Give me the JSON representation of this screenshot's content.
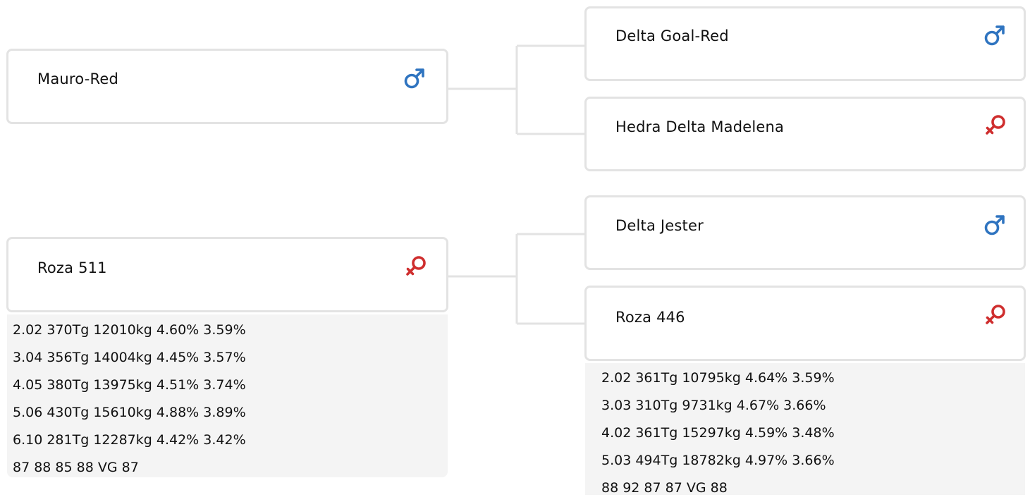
{
  "tree": {
    "left": [
      {
        "name": "Mauro-Red",
        "sex": "male",
        "icon": "male-icon"
      },
      {
        "name": "Roza 511",
        "sex": "female",
        "icon": "female-icon",
        "stats": [
          "2.02 370Tg 12010kg 4.60% 3.59%",
          "3.04 356Tg 14004kg 4.45% 3.57%",
          "4.05 380Tg 13975kg 4.51% 3.74%",
          "5.06 430Tg 15610kg 4.88% 3.89%",
          "6.10 281Tg 12287kg 4.42% 3.42%",
          "87 88 85 88 VG 87"
        ]
      }
    ],
    "right": [
      {
        "name": "Delta Goal-Red",
        "sex": "male",
        "icon": "male-icon"
      },
      {
        "name": "Hedra Delta Madelena",
        "sex": "female",
        "icon": "female-icon"
      },
      {
        "name": "Delta Jester",
        "sex": "male",
        "icon": "male-icon"
      },
      {
        "name": "Roza 446",
        "sex": "female",
        "icon": "female-icon",
        "stats": [
          "2.02 361Tg 10795kg 4.64% 3.59%",
          "3.03 310Tg 9731kg 4.67% 3.66%",
          "4.02 361Tg 15297kg 4.59% 3.48%",
          "5.03 494Tg 18782kg 4.97% 3.66%",
          "88 92 87 87 VG 88"
        ]
      }
    ]
  },
  "colors": {
    "male": "#2f74c0",
    "female": "#cf2e2e",
    "border": "#e3e3e3",
    "connector": "#e3e3e3",
    "stats_bg": "#f4f4f4"
  }
}
